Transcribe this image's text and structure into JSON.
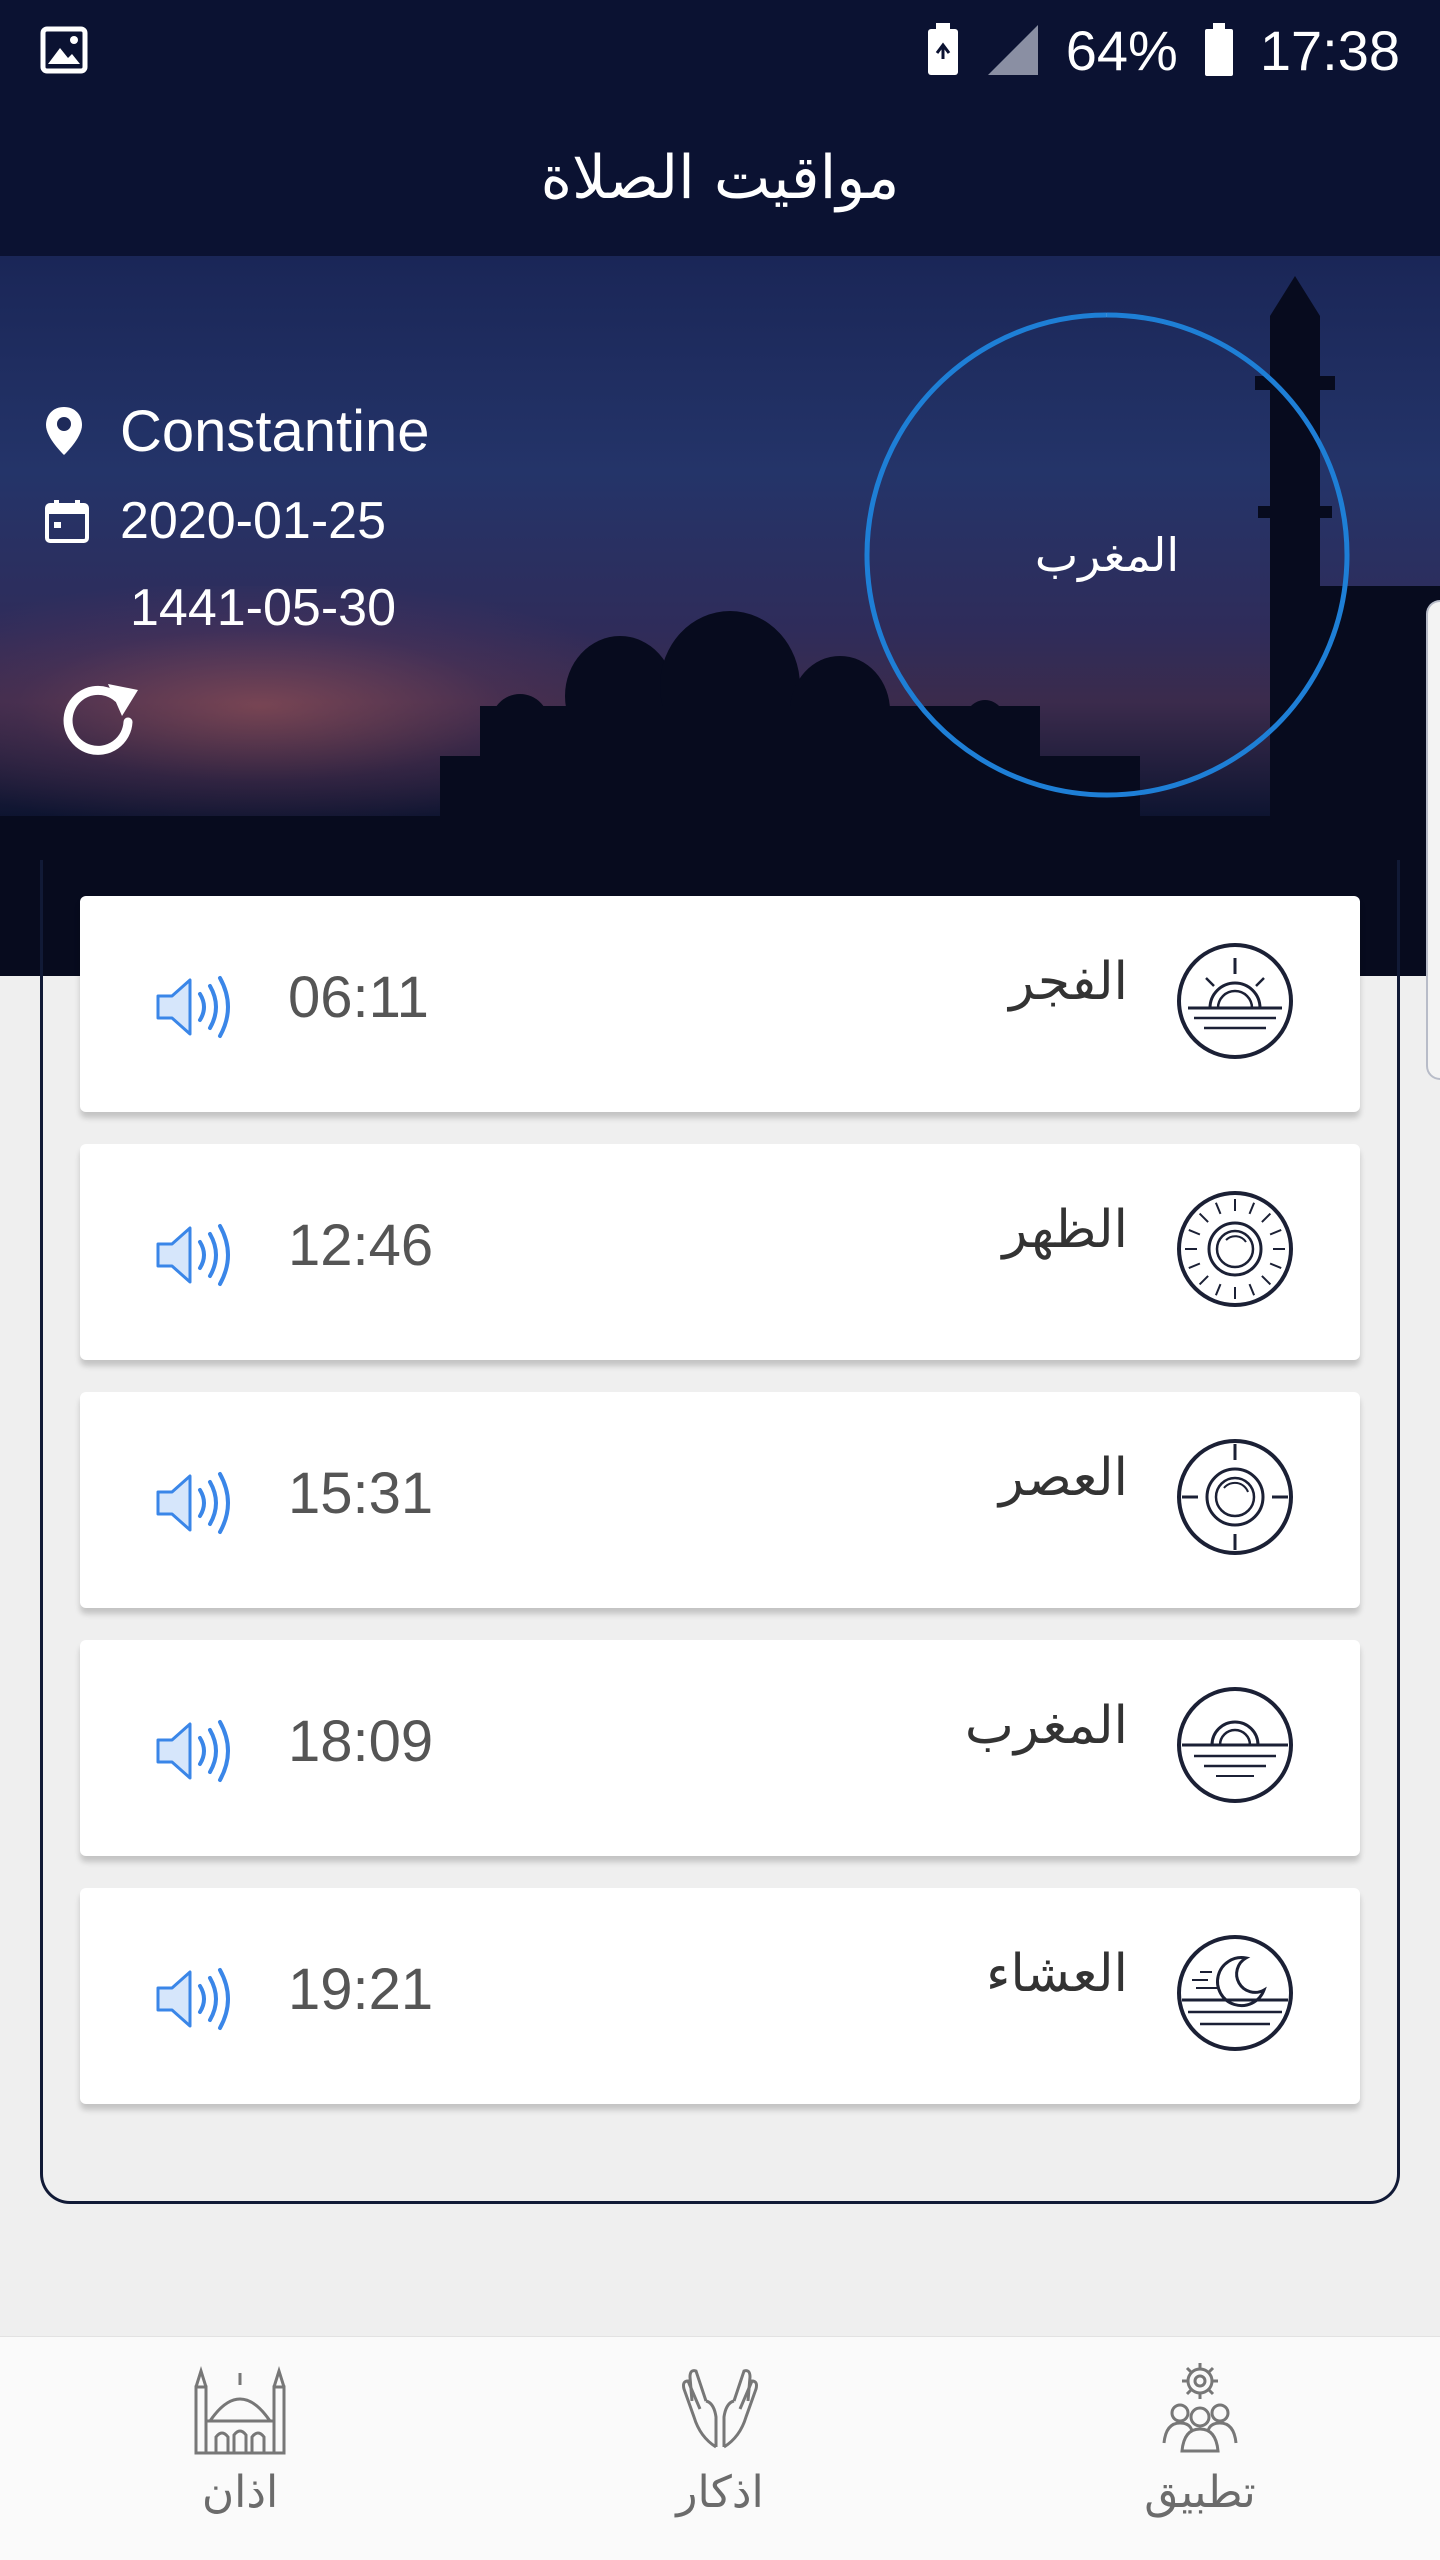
{
  "status_bar": {
    "battery": "64%",
    "time": "17:38"
  },
  "header": {
    "title": "مواقيت الصلاة"
  },
  "location": {
    "city": "Constantine",
    "gregorian_date": "2020-01-25",
    "hijri_date": "1441-05-30"
  },
  "current_prayer": {
    "name": "المغرب",
    "progress": 1.0
  },
  "prayers": [
    {
      "name": "الفجر",
      "time": "06:11",
      "icon": "fajr-sunrise-icon"
    },
    {
      "name": "الظهر",
      "time": "12:46",
      "icon": "dhuhr-sun-icon"
    },
    {
      "name": "العصر",
      "time": "15:31",
      "icon": "asr-sun-icon"
    },
    {
      "name": "المغرب",
      "time": "18:09",
      "icon": "maghrib-sunset-icon"
    },
    {
      "name": "العشاء",
      "time": "19:21",
      "icon": "isha-moon-icon"
    }
  ],
  "nav": {
    "adhan": "اذان",
    "adhkar": "اذكار",
    "app": "تطبيق"
  },
  "colors": {
    "header_bg": "#0b1232",
    "ring": "#1e7fd6",
    "speaker": "#3a86e8"
  }
}
